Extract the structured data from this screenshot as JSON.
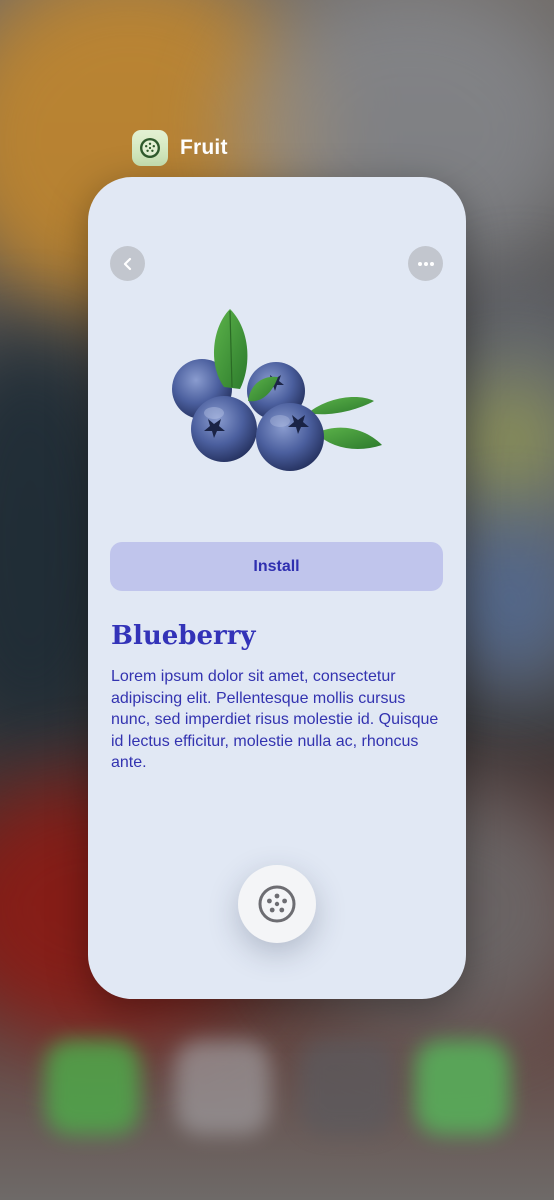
{
  "app_switcher": {
    "app_name": "Fruit",
    "app_icon": "fruit-icon"
  },
  "card": {
    "back_icon": "chevron-left-icon",
    "more_icon": "ellipsis-icon",
    "image_subject": "blueberries-with-leaves",
    "install_label": "Install",
    "title": "Blueberry",
    "description": "Lorem ipsum dolor sit amet, consectetur adipiscing elit. Pellentesque mollis cursus nunc, sed imperdiet risus molestie id. Quisque id lectus efficitur, molestie nulla ac, rhoncus ante.",
    "fab_icon": "fruit-icon"
  },
  "colors": {
    "card_background": "#e1e8f4",
    "accent_text": "#3333b8",
    "install_background": "#c0c5ec",
    "leaf_green": "#3f9a3a",
    "berry_blue": "#4a5c9c"
  }
}
